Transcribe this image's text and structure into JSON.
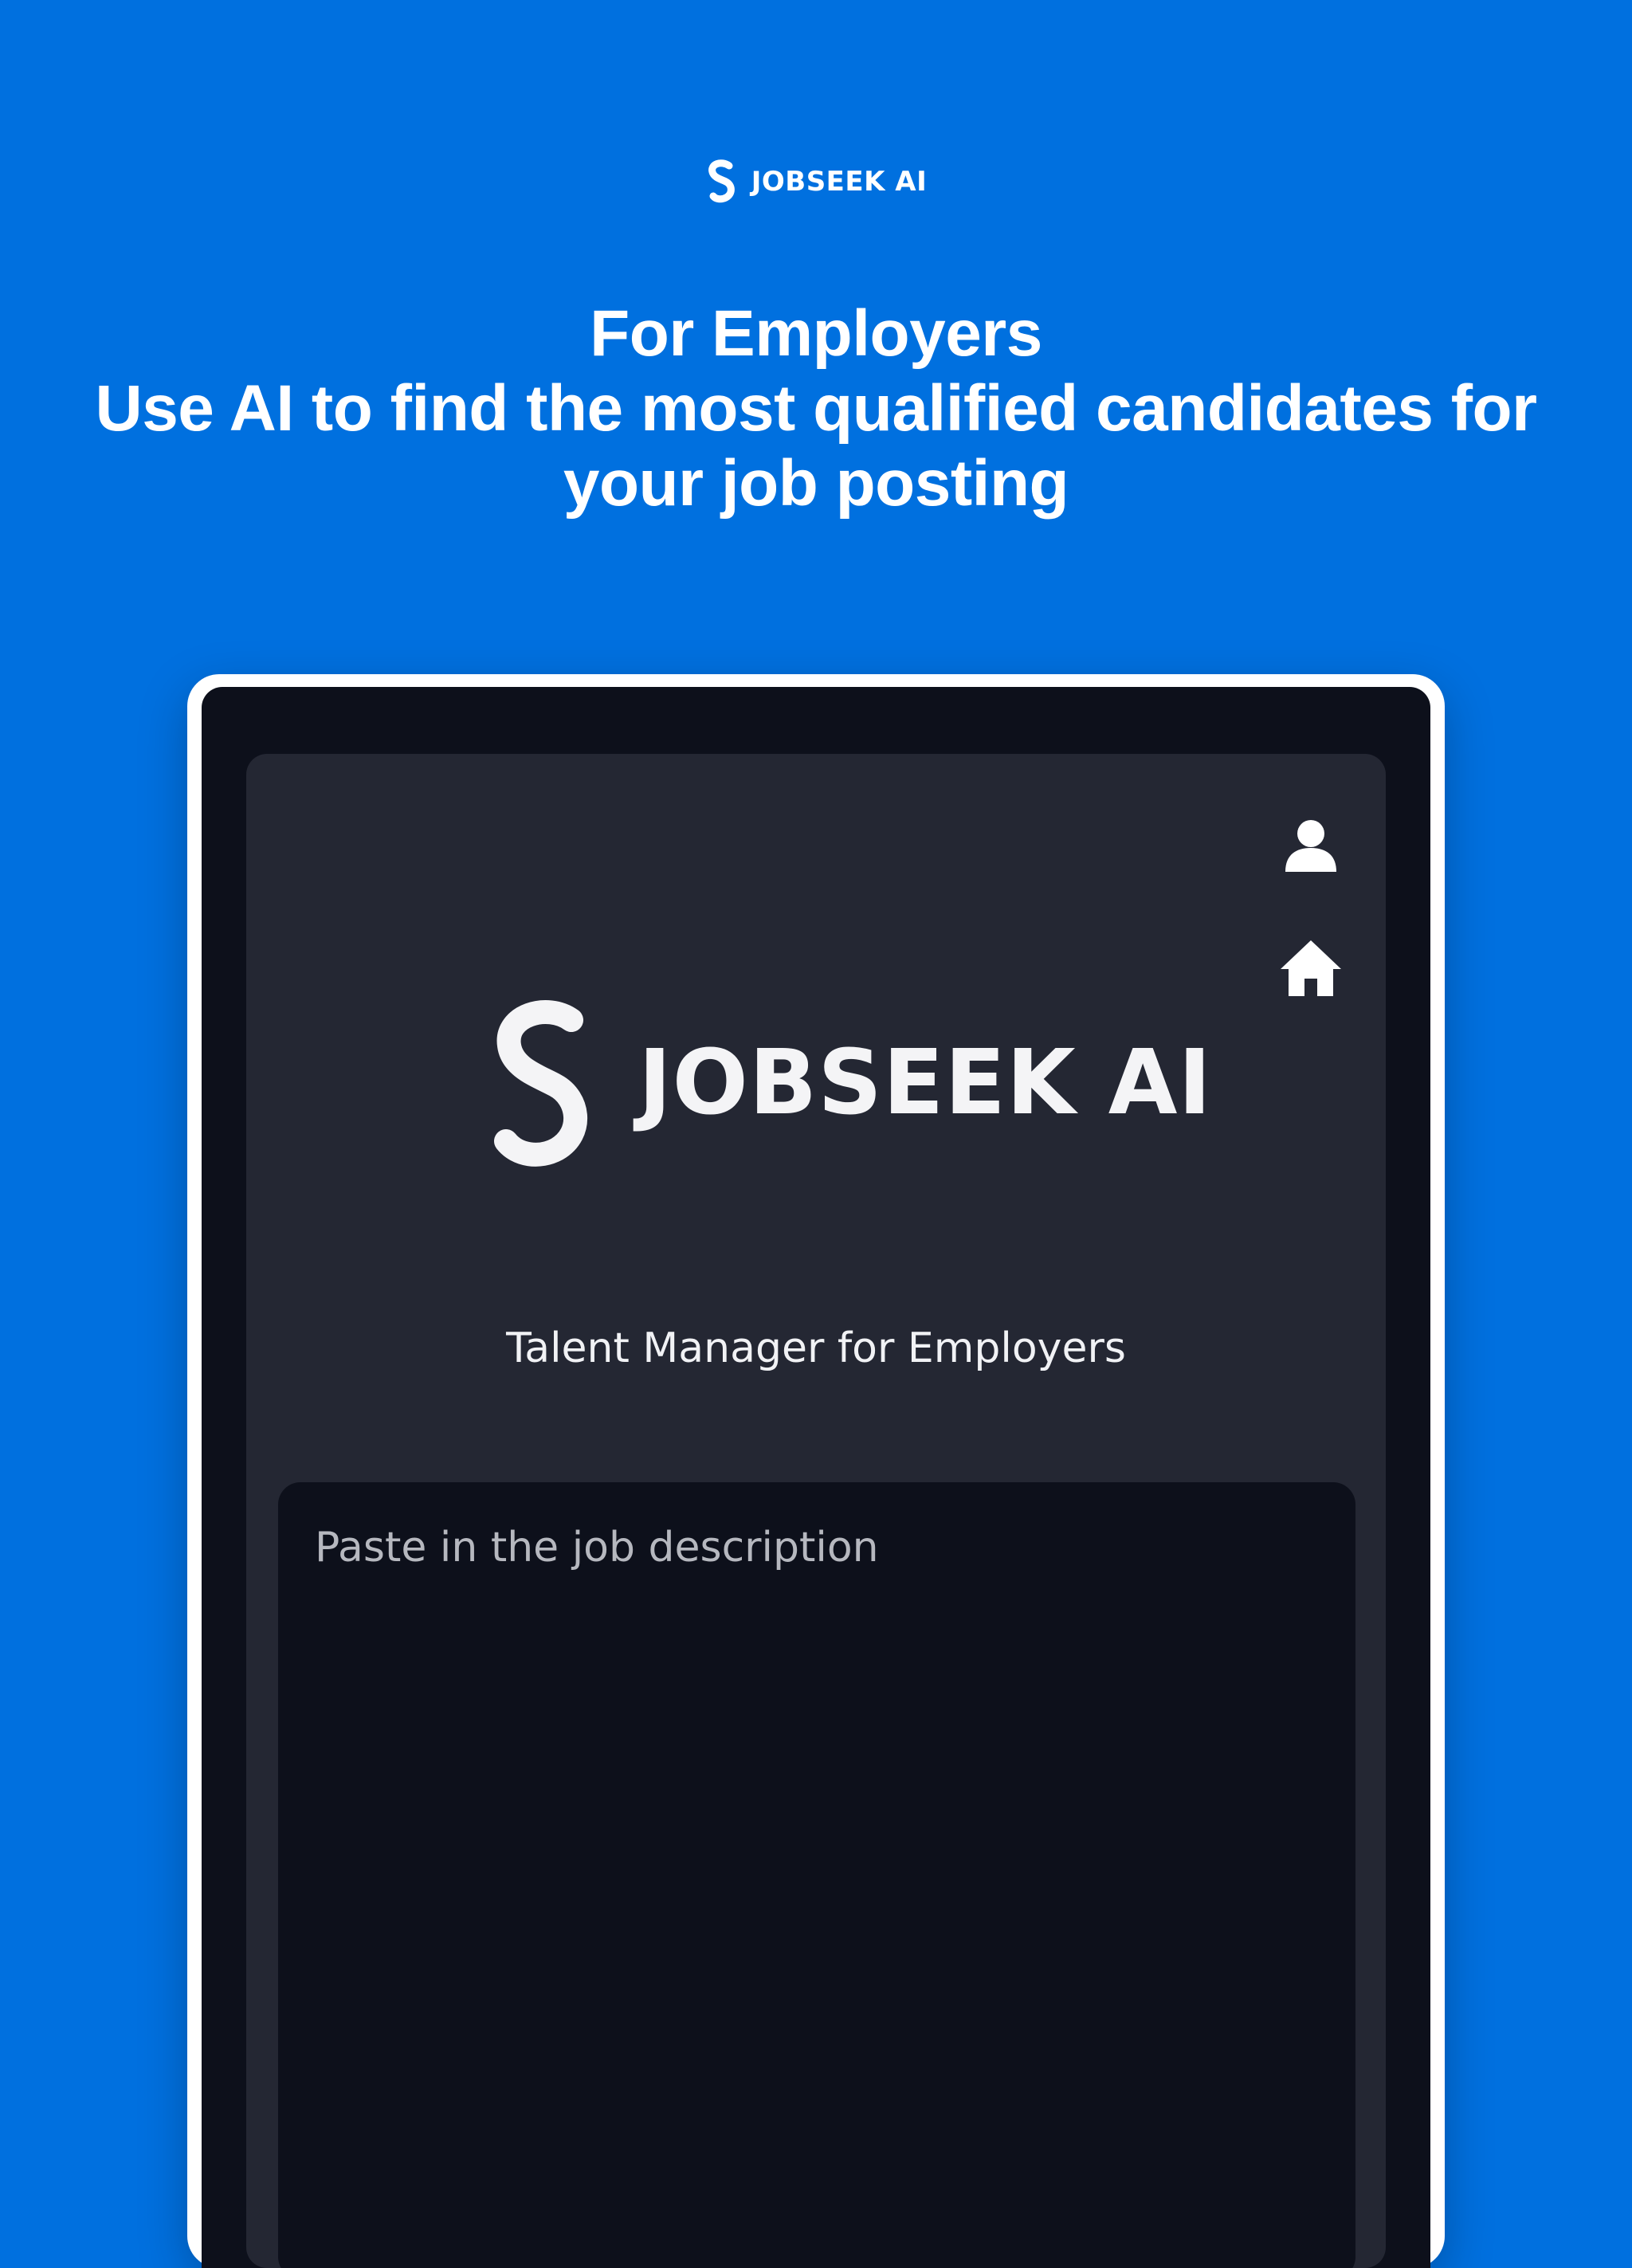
{
  "brand": {
    "name": "JOBSEEK AI"
  },
  "headline": {
    "line1": "For Employers",
    "line2": "Use AI to find the most qualified candidates for",
    "line3": "your job posting"
  },
  "app": {
    "logo_text": "JOBSEEK AI",
    "subtitle": "Talent Manager for Employers",
    "job_description": {
      "value": "",
      "placeholder": "Paste in the job description"
    },
    "icons": {
      "profile": "person-icon",
      "home": "home-icon"
    }
  },
  "colors": {
    "background": "#0070df",
    "device_frame": "#ffffff",
    "screen": "#0d101b",
    "card": "#242733",
    "text_primary": "#ffffff"
  }
}
